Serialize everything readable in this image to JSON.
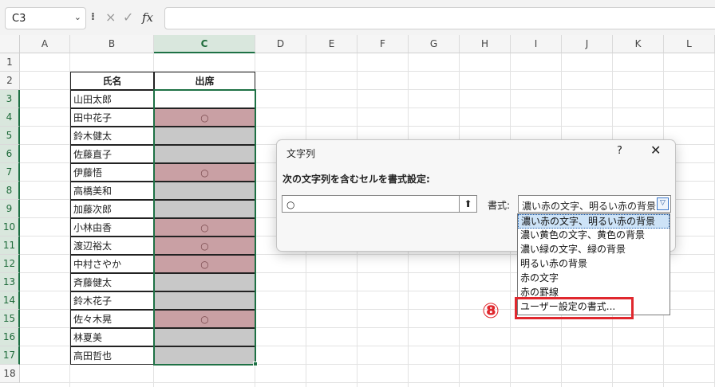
{
  "formula_bar": {
    "name_box": "C3",
    "separator": "⁝",
    "cancel_icon": "×",
    "enter_icon": "✓",
    "fx_label": "fx",
    "formula_value": ""
  },
  "columns": [
    "A",
    "B",
    "C",
    "D",
    "E",
    "F",
    "G",
    "H",
    "I",
    "J",
    "K",
    "L"
  ],
  "rows": [
    "1",
    "2",
    "3",
    "4",
    "5",
    "6",
    "7",
    "8",
    "9",
    "10",
    "11",
    "12",
    "13",
    "14",
    "15",
    "16",
    "17",
    "18"
  ],
  "table": {
    "header_name": "氏名",
    "header_attendance": "出席",
    "attendance_mark": "○",
    "entries": [
      {
        "name": "山田太郎",
        "present": ""
      },
      {
        "name": "田中花子",
        "present": "○"
      },
      {
        "name": "鈴木健太",
        "present": ""
      },
      {
        "name": "佐藤直子",
        "present": ""
      },
      {
        "name": "伊藤悟",
        "present": "○"
      },
      {
        "name": "高橋美和",
        "present": ""
      },
      {
        "name": "加藤次郎",
        "present": ""
      },
      {
        "name": "小林由香",
        "present": "○"
      },
      {
        "name": "渡辺裕太",
        "present": "○"
      },
      {
        "name": "中村さやか",
        "present": "○"
      },
      {
        "name": "斉藤健太",
        "present": ""
      },
      {
        "name": "鈴木花子",
        "present": ""
      },
      {
        "name": "佐々木晃",
        "present": "○"
      },
      {
        "name": "林夏美",
        "present": ""
      },
      {
        "name": "高田哲也",
        "present": ""
      }
    ]
  },
  "dialog": {
    "title": "文字列",
    "help": "?",
    "close": "✕",
    "instruction": "次の文字列を含むセルを書式設定:",
    "input_value": "○",
    "collapse_icon": "⬆",
    "format_label": "書式:",
    "format_selected": "濃い赤の文字、明るい赤の背景",
    "dropdown_arrow": "▽",
    "options": [
      "濃い赤の文字、明るい赤の背景",
      "濃い黄色の文字、黄色の背景",
      "濃い緑の文字、緑の背景",
      "明るい赤の背景",
      "赤の文字",
      "赤の罫線",
      "ユーザー設定の書式..."
    ]
  },
  "callout": {
    "number": "⑧",
    "color": "#e0282e"
  },
  "colors": {
    "highlight_fill": "#c9a0a4",
    "gray_fill": "#c8c8c8",
    "selection": "#1e7145"
  }
}
